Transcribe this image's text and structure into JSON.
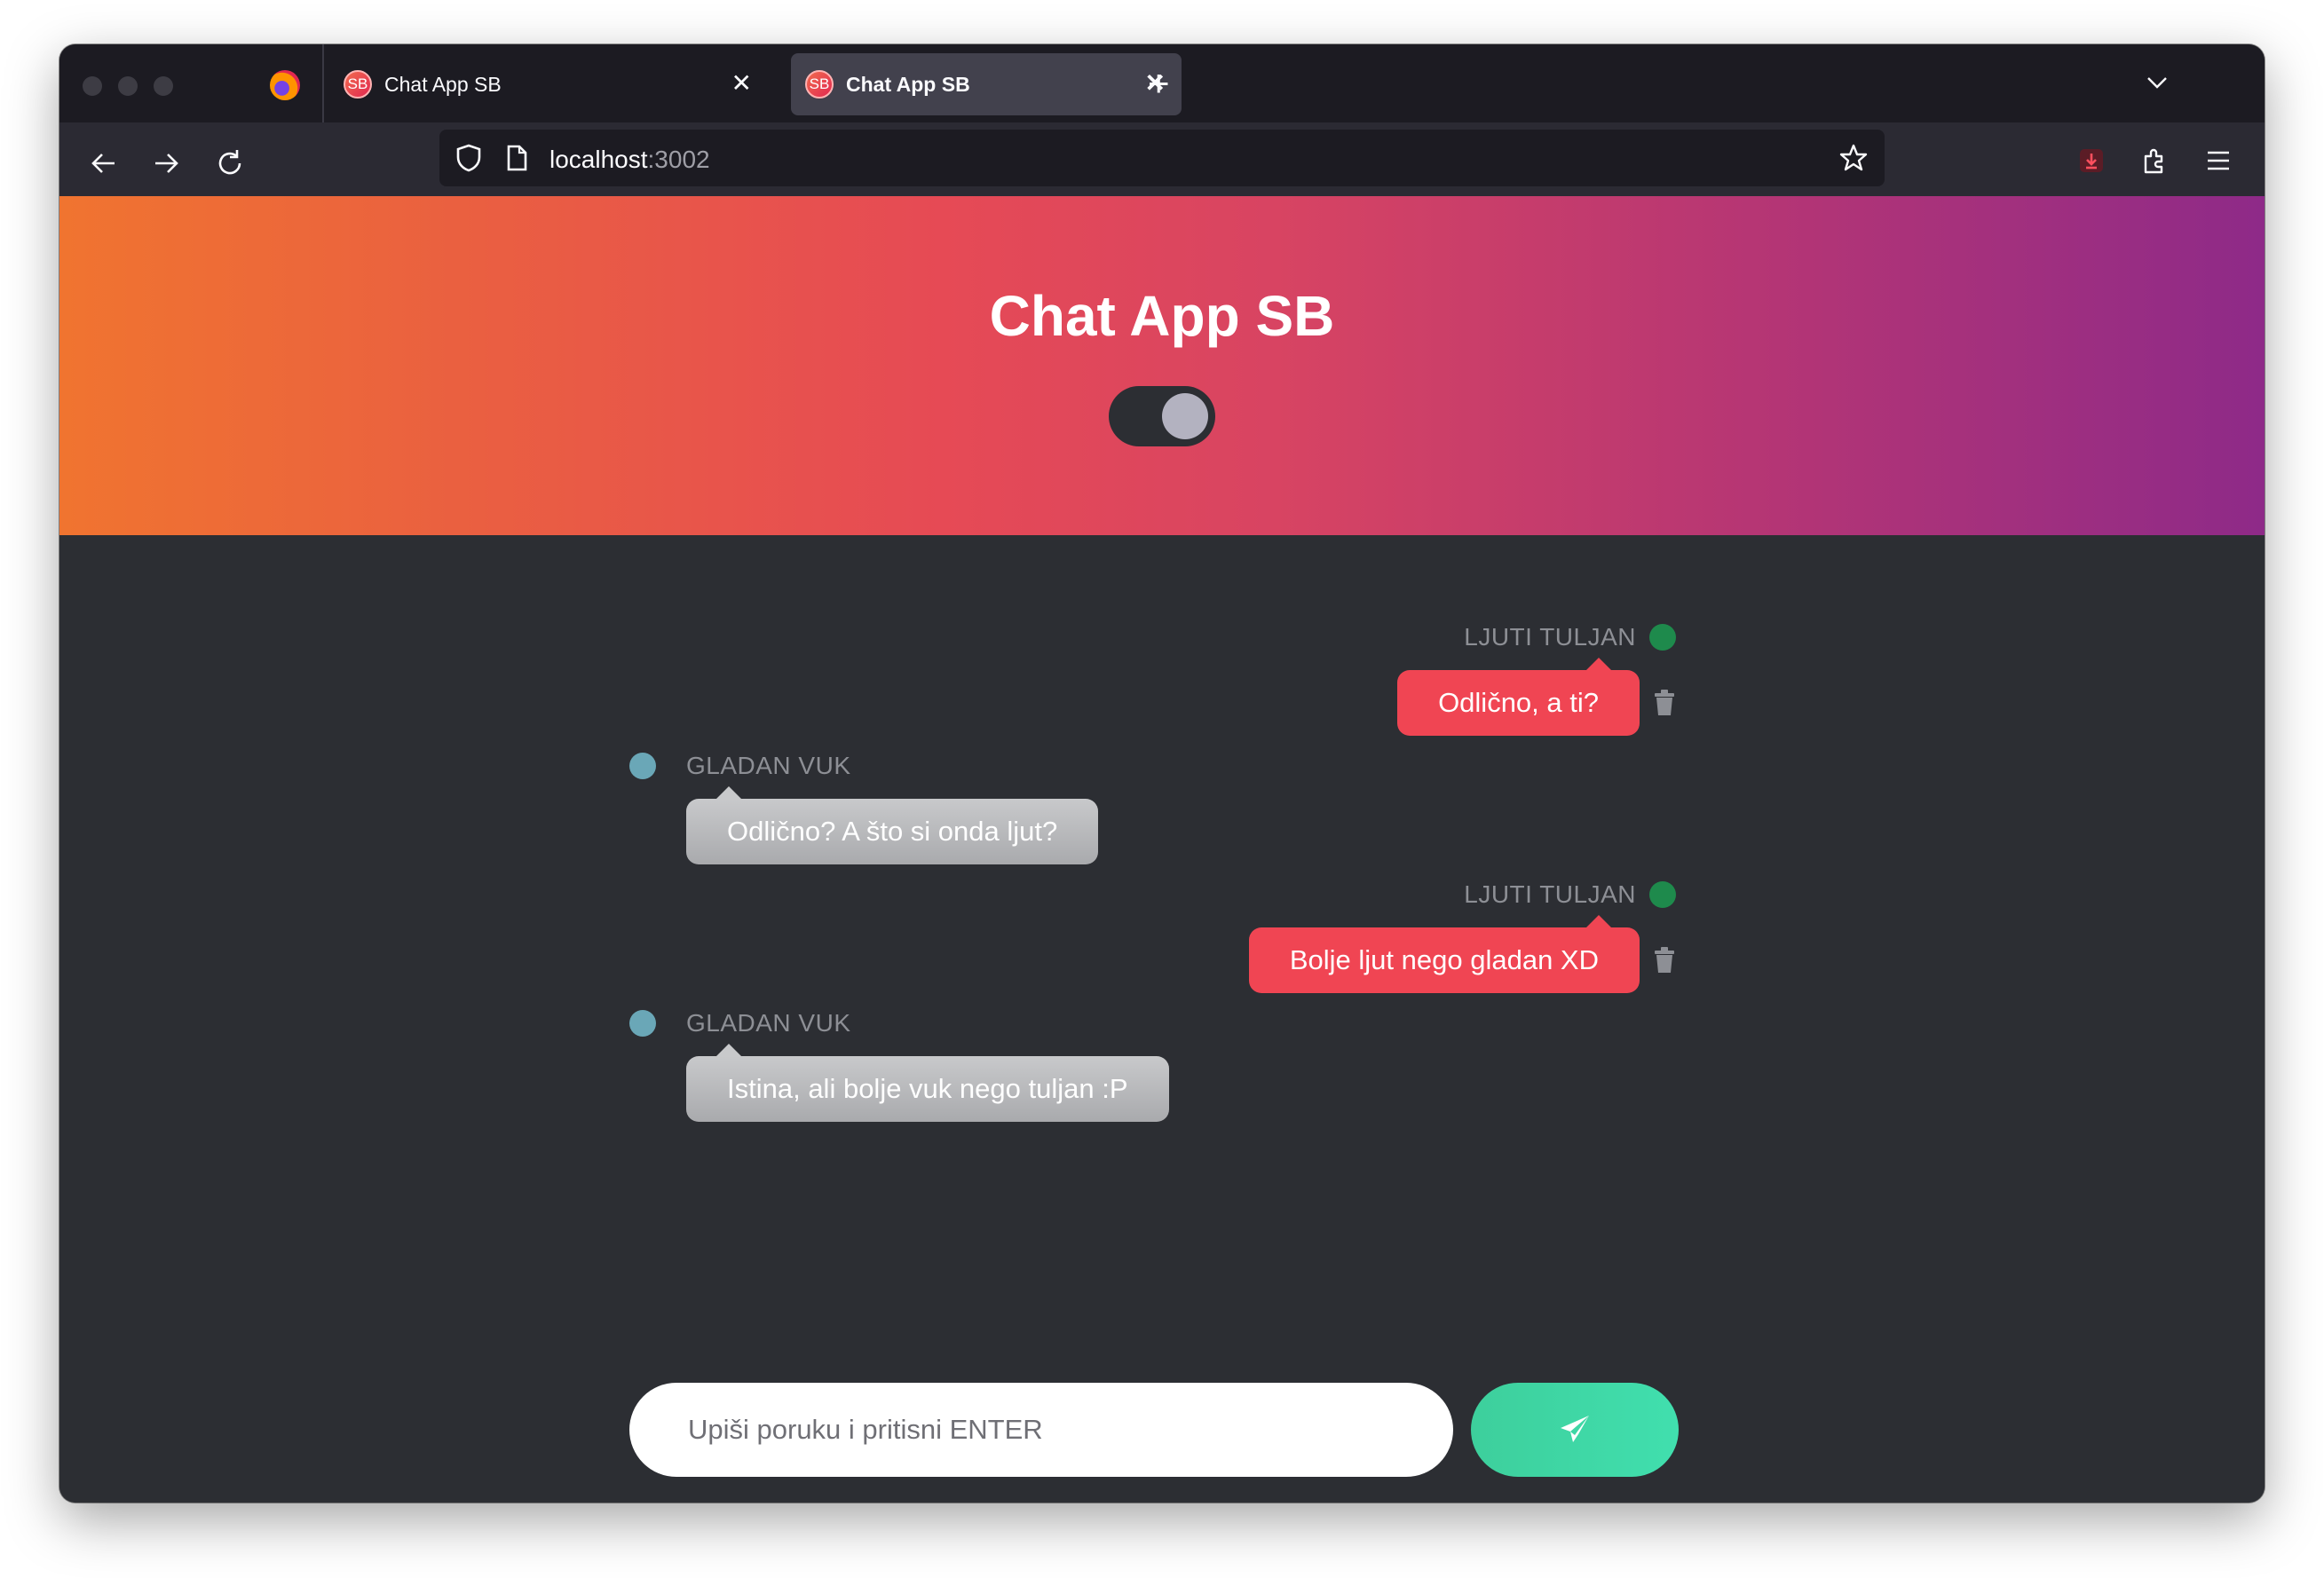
{
  "browser": {
    "tabs": [
      {
        "favicon": "SB",
        "title": "Chat App SB"
      },
      {
        "favicon": "SB",
        "title": "Chat App SB"
      }
    ],
    "url": {
      "host": "localhost",
      "port": ":3002"
    }
  },
  "app": {
    "title": "Chat App SB",
    "theme_toggle": {
      "state": "on"
    }
  },
  "messages": [
    {
      "author": "LJUTI TULJAN",
      "text": "Odlično, a ti?",
      "own": true,
      "color": "#1e8a4c"
    },
    {
      "author": "GLADAN VUK",
      "text": "Odlično? A što si onda ljut?",
      "own": false,
      "color": "#6aa7b7"
    },
    {
      "author": "LJUTI TULJAN",
      "text": "Bolje ljut nego gladan XD",
      "own": true,
      "color": "#1e8a4c"
    },
    {
      "author": "GLADAN VUK",
      "text": "Istina, ali bolje vuk nego tuljan :P",
      "own": false,
      "color": "#6aa7b7"
    }
  ],
  "composer": {
    "placeholder": "Upiši poruku i pritisni ENTER",
    "send_icon": "paper-plane-icon"
  },
  "colors": {
    "own_bubble": "#f04553",
    "send_button": "#3dd8a5",
    "header_gradient_start": "#f07430",
    "header_gradient_end": "#8e2a88"
  }
}
